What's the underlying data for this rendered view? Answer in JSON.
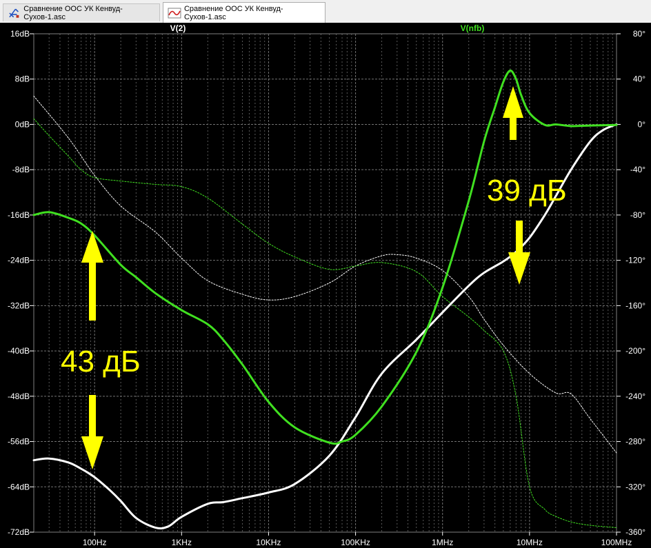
{
  "tabs": [
    {
      "label": "Сравнение ООС УК Кенвуд-Сухов-1.asc",
      "icon": "schematic-icon",
      "active": false
    },
    {
      "label": "Сравнение ООС УК Кенвуд-Сухов-1.asc",
      "icon": "waveform-icon",
      "active": true
    }
  ],
  "colors": {
    "background": "#000000",
    "grid": "#808080",
    "axis_text": "#ffffff",
    "v2": "#ffffff",
    "vnfb": "#40e020",
    "annotation": "#ffff00"
  },
  "chart_data": {
    "type": "line",
    "xscale": "log",
    "xlim": [
      20,
      100000000
    ],
    "x_ticks": [
      {
        "value": 100,
        "label": "100Hz"
      },
      {
        "value": 1000,
        "label": "1KHz"
      },
      {
        "value": 10000,
        "label": "10KHz"
      },
      {
        "value": 100000,
        "label": "100KHz"
      },
      {
        "value": 1000000,
        "label": "1MHz"
      },
      {
        "value": 10000000,
        "label": "10MHz"
      },
      {
        "value": 100000000,
        "label": "100MHz"
      }
    ],
    "ylim_left": [
      -72,
      16
    ],
    "y_left_ticks": [
      {
        "value": 16,
        "label": "16dB"
      },
      {
        "value": 8,
        "label": "8dB"
      },
      {
        "value": 0,
        "label": "0dB"
      },
      {
        "value": -8,
        "label": "-8dB"
      },
      {
        "value": -16,
        "label": "-16dB"
      },
      {
        "value": -24,
        "label": "-24dB"
      },
      {
        "value": -32,
        "label": "-32dB"
      },
      {
        "value": -40,
        "label": "-40dB"
      },
      {
        "value": -48,
        "label": "-48dB"
      },
      {
        "value": -56,
        "label": "-56dB"
      },
      {
        "value": -64,
        "label": "-64dB"
      },
      {
        "value": -72,
        "label": "-72dB"
      }
    ],
    "ylim_right": [
      -360,
      80
    ],
    "y_right_ticks": [
      {
        "value": 80,
        "label": "80°"
      },
      {
        "value": 40,
        "label": "40°"
      },
      {
        "value": 0,
        "label": "0°"
      },
      {
        "value": -40,
        "label": "-40°"
      },
      {
        "value": -80,
        "label": "-80°"
      },
      {
        "value": -120,
        "label": "-120°"
      },
      {
        "value": -160,
        "label": "-160°"
      },
      {
        "value": -200,
        "label": "-200°"
      },
      {
        "value": -240,
        "label": "-240°"
      },
      {
        "value": -280,
        "label": "-280°"
      },
      {
        "value": -320,
        "label": "-320°"
      },
      {
        "value": -360,
        "label": "-360°"
      }
    ],
    "grid": true,
    "series": [
      {
        "name": "V(2)",
        "quantity": "magnitude",
        "axis": "left",
        "style": "solid",
        "color": "#ffffff",
        "x": [
          20,
          30,
          50,
          70,
          100,
          150,
          200,
          300,
          500,
          700,
          1000,
          2000,
          3000,
          5000,
          10000,
          20000,
          50000,
          100000,
          200000,
          500000,
          1000000,
          2000000,
          3000000,
          5000000,
          7000000,
          10000000,
          15000000,
          20000000,
          30000000,
          50000000,
          70000000,
          100000000
        ],
        "y": [
          -59.3,
          -59.0,
          -59.7,
          -60.8,
          -62.3,
          -64.6,
          -66.5,
          -69.5,
          -71.2,
          -71.0,
          -69.3,
          -67.0,
          -66.7,
          -66.0,
          -65.0,
          -63.5,
          -58.5,
          -51.7,
          -44.0,
          -38.0,
          -33.2,
          -28.5,
          -26.2,
          -24.2,
          -22.5,
          -20.0,
          -16.0,
          -12.7,
          -8.0,
          -3.0,
          -1.0,
          0.0
        ]
      },
      {
        "name": "V(nfb)",
        "quantity": "magnitude",
        "axis": "left",
        "style": "solid",
        "color": "#40e020",
        "x": [
          20,
          30,
          50,
          70,
          100,
          200,
          300,
          500,
          1000,
          2000,
          3000,
          5000,
          10000,
          20000,
          50000,
          70000,
          100000,
          200000,
          500000,
          1000000,
          2000000,
          3000000,
          4000000,
          5000000,
          6000000,
          7000000,
          8000000,
          10000000,
          15000000,
          20000000,
          30000000,
          50000000,
          100000000
        ],
        "y": [
          -16.0,
          -15.5,
          -16.5,
          -17.5,
          -19.6,
          -24.8,
          -27.0,
          -29.8,
          -32.8,
          -35.3,
          -38.0,
          -42.4,
          -49.0,
          -53.5,
          -56.2,
          -56.0,
          -54.8,
          -49.8,
          -40.2,
          -28.8,
          -13.5,
          -3.0,
          3.0,
          7.5,
          9.5,
          8.0,
          5.2,
          2.0,
          -0.1,
          0.0,
          -0.3,
          -0.2,
          -0.1
        ]
      },
      {
        "name": "V(2) phase",
        "quantity": "phase",
        "axis": "right",
        "style": "dashed",
        "color": "#ffffff",
        "x": [
          20,
          50,
          100,
          200,
          500,
          1000,
          2000,
          5000,
          10000,
          20000,
          50000,
          100000,
          200000,
          300000,
          500000,
          1000000,
          2000000,
          3000000,
          5000000,
          10000000,
          20000000,
          30000000,
          50000000,
          100000000
        ],
        "y": [
          25,
          -12,
          -45,
          -72,
          -95,
          -118,
          -138,
          -150,
          -155,
          -152,
          -140,
          -125,
          -116,
          -115,
          -118,
          -129,
          -152,
          -172,
          -195,
          -220,
          -237,
          -238,
          -260,
          -290
        ]
      },
      {
        "name": "V(nfb) phase",
        "quantity": "phase",
        "axis": "right",
        "style": "dashed",
        "color": "#40e020",
        "x": [
          20,
          30,
          50,
          70,
          100,
          200,
          500,
          1000,
          2000,
          5000,
          10000,
          20000,
          50000,
          100000,
          200000,
          500000,
          1000000,
          2000000,
          3000000,
          5000000,
          7000000,
          10000000,
          15000000,
          20000000,
          30000000,
          50000000,
          100000000
        ],
        "y": [
          5,
          -10,
          -28,
          -40,
          -47,
          -50,
          -53,
          -55,
          -65,
          -88,
          -105,
          -117,
          -128,
          -125,
          -122,
          -130,
          -152,
          -170,
          -182,
          -200,
          -240,
          -320,
          -340,
          -346,
          -351,
          -354,
          -356
        ]
      }
    ],
    "trace_labels": [
      {
        "text": "V(2)",
        "color": "#ffffff"
      },
      {
        "text": "V(nfb)",
        "color": "#40e020"
      }
    ],
    "annotations": [
      {
        "text": "43 дБ",
        "color": "#ffff00"
      },
      {
        "text": "39 дБ",
        "color": "#ffff00"
      }
    ]
  }
}
